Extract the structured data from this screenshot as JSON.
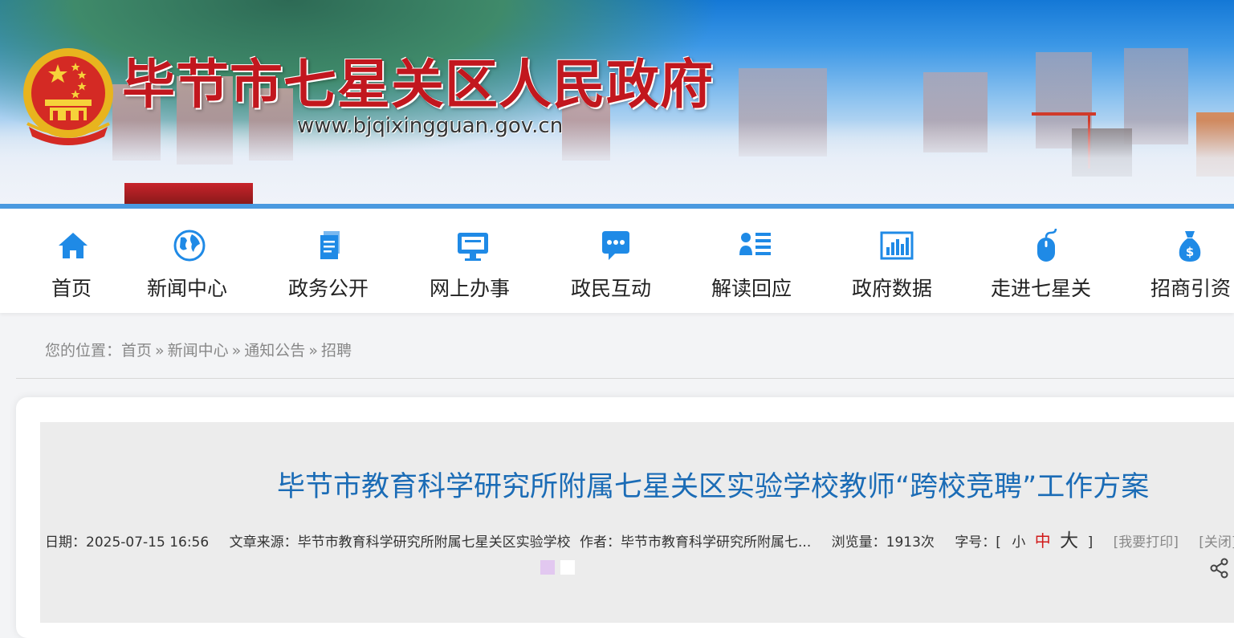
{
  "header": {
    "site_title": "毕节市七星关区人民政府",
    "site_url": "www.bjqixingguan.gov.cn",
    "emblem_icon": "national-emblem-icon"
  },
  "nav": {
    "items": [
      {
        "label": "首页",
        "icon": "home-icon"
      },
      {
        "label": "新闻中心",
        "icon": "globe-icon"
      },
      {
        "label": "政务公开",
        "icon": "document-icon"
      },
      {
        "label": "网上办事",
        "icon": "monitor-icon"
      },
      {
        "label": "政民互动",
        "icon": "chat-icon"
      },
      {
        "label": "解读回应",
        "icon": "user-list-icon"
      },
      {
        "label": "政府数据",
        "icon": "bar-chart-icon"
      },
      {
        "label": "走进七星关",
        "icon": "mouse-icon"
      },
      {
        "label": "招商引资",
        "icon": "money-bag-icon"
      }
    ]
  },
  "breadcrumb": {
    "prefix": "您的位置：",
    "items": [
      "首页",
      "新闻中心",
      "通知公告",
      "招聘"
    ],
    "separator": "»"
  },
  "article": {
    "title": "毕节市教育科学研究所附属七星关区实验学校教师“跨校竞聘”工作方案",
    "date": "日期：2025-07-15 16:56",
    "source": "文章来源：毕节市教育科学研究所附属七星关区实验学校",
    "author": "作者：毕节市教育科学研究所附属七...",
    "views": "浏览量：1913次",
    "font_size_label": "字号：[",
    "font_small": "小",
    "font_mid": "中",
    "font_big": "大",
    "font_close": "]",
    "print": "[我要打印]",
    "close": "[关闭]"
  },
  "colors": {
    "nav_icon": "#1f8ae6",
    "title_blue": "#1b6cb6",
    "header_red": "#c2171e",
    "font_mid_red": "#d11a1a"
  }
}
